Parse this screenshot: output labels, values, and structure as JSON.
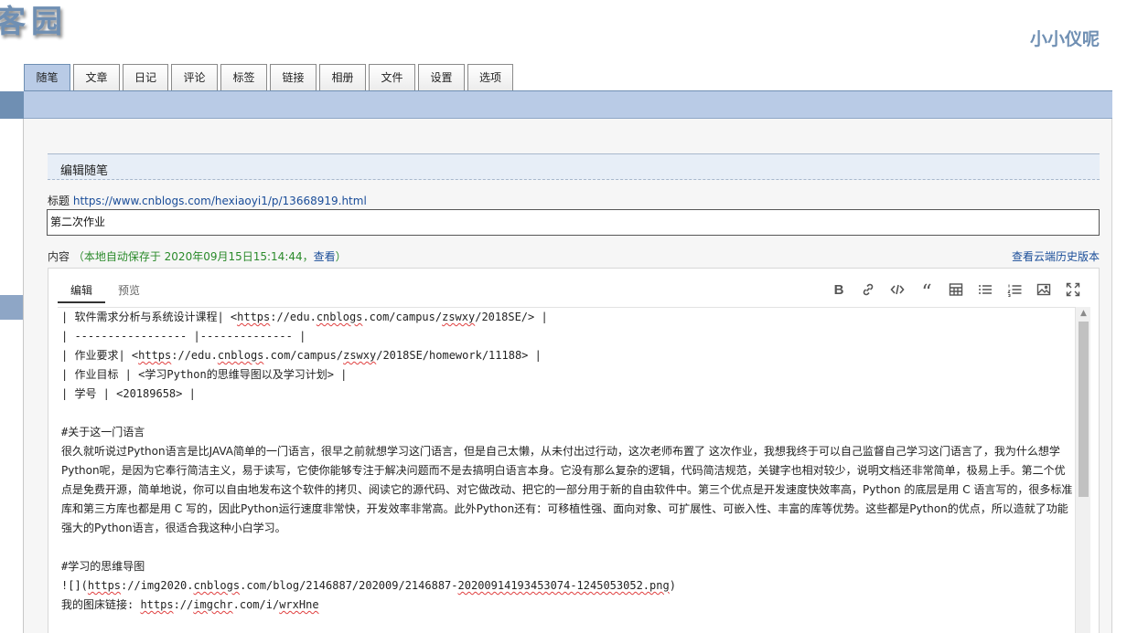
{
  "header": {
    "logo_text": "客园",
    "username": "小小仪呢"
  },
  "nav": {
    "tabs": [
      {
        "label": "随笔",
        "active": true
      },
      {
        "label": "文章",
        "active": false
      },
      {
        "label": "日记",
        "active": false
      },
      {
        "label": "评论",
        "active": false
      },
      {
        "label": "标签",
        "active": false
      },
      {
        "label": "链接",
        "active": false
      },
      {
        "label": "相册",
        "active": false
      },
      {
        "label": "文件",
        "active": false
      },
      {
        "label": "设置",
        "active": false
      },
      {
        "label": "选项",
        "active": false
      }
    ]
  },
  "form": {
    "section_title": "编辑随笔",
    "title_label": "标题",
    "title_url": "https://www.cnblogs.com/hexiaoyi1/p/13668919.html",
    "title_value": "第二次作业",
    "content_label": "内容",
    "autosave_prefix": "（本地自动保存于 2020年09月15日15:14:44，",
    "autosave_view": "查看",
    "autosave_suffix": "）",
    "history_link": "查看云端历史版本"
  },
  "editor": {
    "tab_edit": "编辑",
    "tab_preview": "预览",
    "toolbar": [
      "bold-icon",
      "link-icon",
      "code-icon",
      "quote-icon",
      "table-icon",
      "bullet-list-icon",
      "numbered-list-icon",
      "image-icon",
      "fullscreen-icon"
    ],
    "lines": [
      "| 软件需求分析与系统设计课程| <https://edu.cnblogs.com/campus/zswxy/2018SE/> |",
      "| ----------------- |-------------- |",
      "| 作业要求| <https://edu.cnblogs.com/campus/zswxy/2018SE/homework/11188> |",
      "| 作业目标 | <学习Python的思维导图以及学习计划> |",
      "| 学号 | <20189658> |",
      "",
      "#关于这一门语言",
      "很久就听说过Python语言是比JAVA简单的一门语言，很早之前就想学习这门语言，但是自己太懒，从未付出过行动，这次老师布置了 这次作业，我想我终于可以自己监督自己学习这门语言了，我为什么想学Python呢，是因为它奉行简洁主义，易于读写，它使你能够专注于解决问题而不是去搞明白语言本身。它没有那么复杂的逻辑，代码简洁规范，关键字也相对较少，说明文档还非常简单，极易上手。第二个优点是免费开源，简单地说，你可以自由地发布这个软件的拷贝、阅读它的源代码、对它做改动、把它的一部分用于新的自由软件中。第三个优点是开发速度快效率高，Python 的底层是用 C 语言写的，很多标准库和第三方库也都是用 C 写的，因此Python运行速度非常快，开发效率非常高。此外Python还有：可移植性强、面向对象、可扩展性、可嵌入性、丰富的库等优势。这些都是Python的优点，所以造就了功能强大的Python语言，很适合我这种小白学习。",
      "",
      "#学习的思维导图",
      "![](https://img2020.cnblogs.com/blog/2146887/202009/2146887-20200914193453074-1245053052.png)",
      "我的图床链接: https://imgchr.com/i/wrxHne"
    ]
  },
  "colors": {
    "brand": "#6f8fb3",
    "tab_bar": "#b9cbe6",
    "link": "#1a4d99",
    "autosave": "#2a8a2a"
  }
}
